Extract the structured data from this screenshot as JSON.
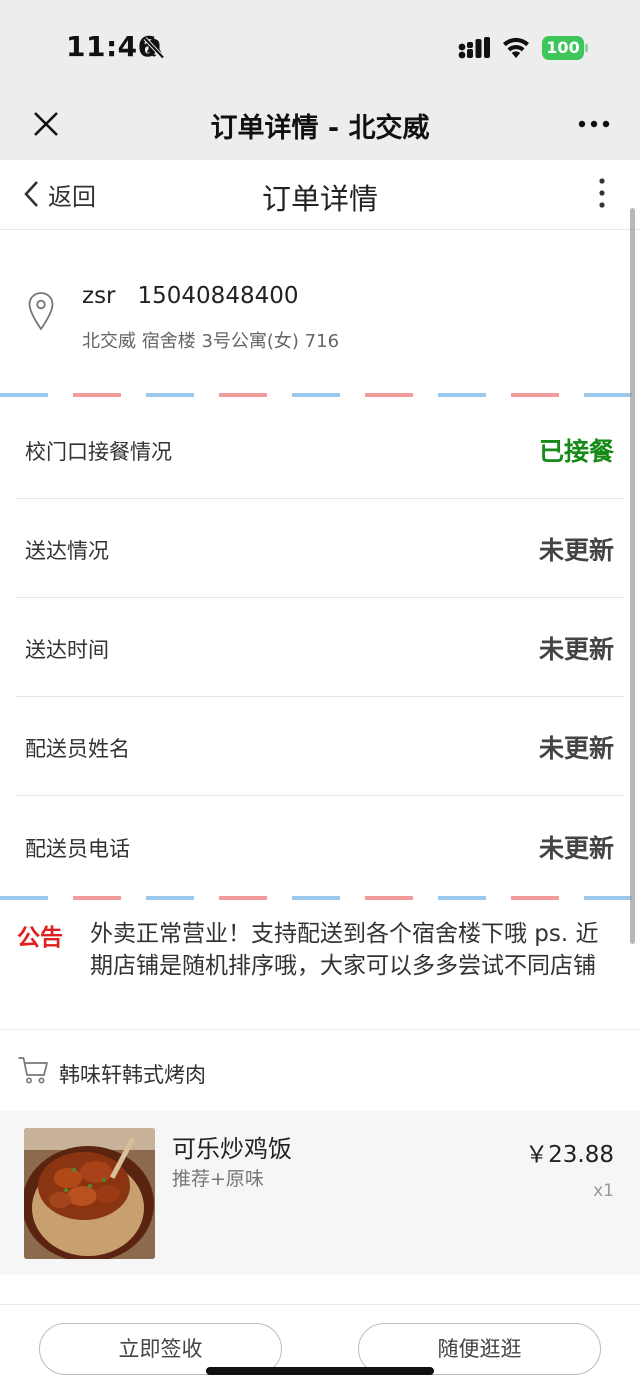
{
  "status_bar": {
    "time": "11:46",
    "battery": "100"
  },
  "app_header": {
    "title": "订单详情 - 北交威"
  },
  "page_nav": {
    "back_label": "返回",
    "title": "订单详情"
  },
  "address": {
    "name": "zsr",
    "phone": "15040848400",
    "detail": "北交威 宿舍楼 3号公寓(女) 716"
  },
  "status_rows": [
    {
      "label": "校门口接餐情况",
      "value": "已接餐",
      "value_color": "#168a16"
    },
    {
      "label": "送达情况",
      "value": "未更新"
    },
    {
      "label": "送达时间",
      "value": "未更新"
    },
    {
      "label": "配送员姓名",
      "value": "未更新"
    },
    {
      "label": "配送员电话",
      "value": "未更新"
    }
  ],
  "notice": {
    "tag": "公告",
    "text": "外卖正常营业！支持配送到各个宿舍楼下哦 ps. 近期店铺是随机排序哦，大家可以多多尝试不同店铺"
  },
  "shop": {
    "name": "韩味轩韩式烤肉"
  },
  "item": {
    "name": "可乐炒鸡饭",
    "spec": "推荐+原味",
    "price": "￥23.88",
    "qty": "x1"
  },
  "buttons": {
    "sign": "立即签收",
    "browse": "随便逛逛"
  },
  "colors": {
    "accent_green": "#168a16",
    "notice_red": "#e02020",
    "battery_green": "#3dc65a"
  }
}
